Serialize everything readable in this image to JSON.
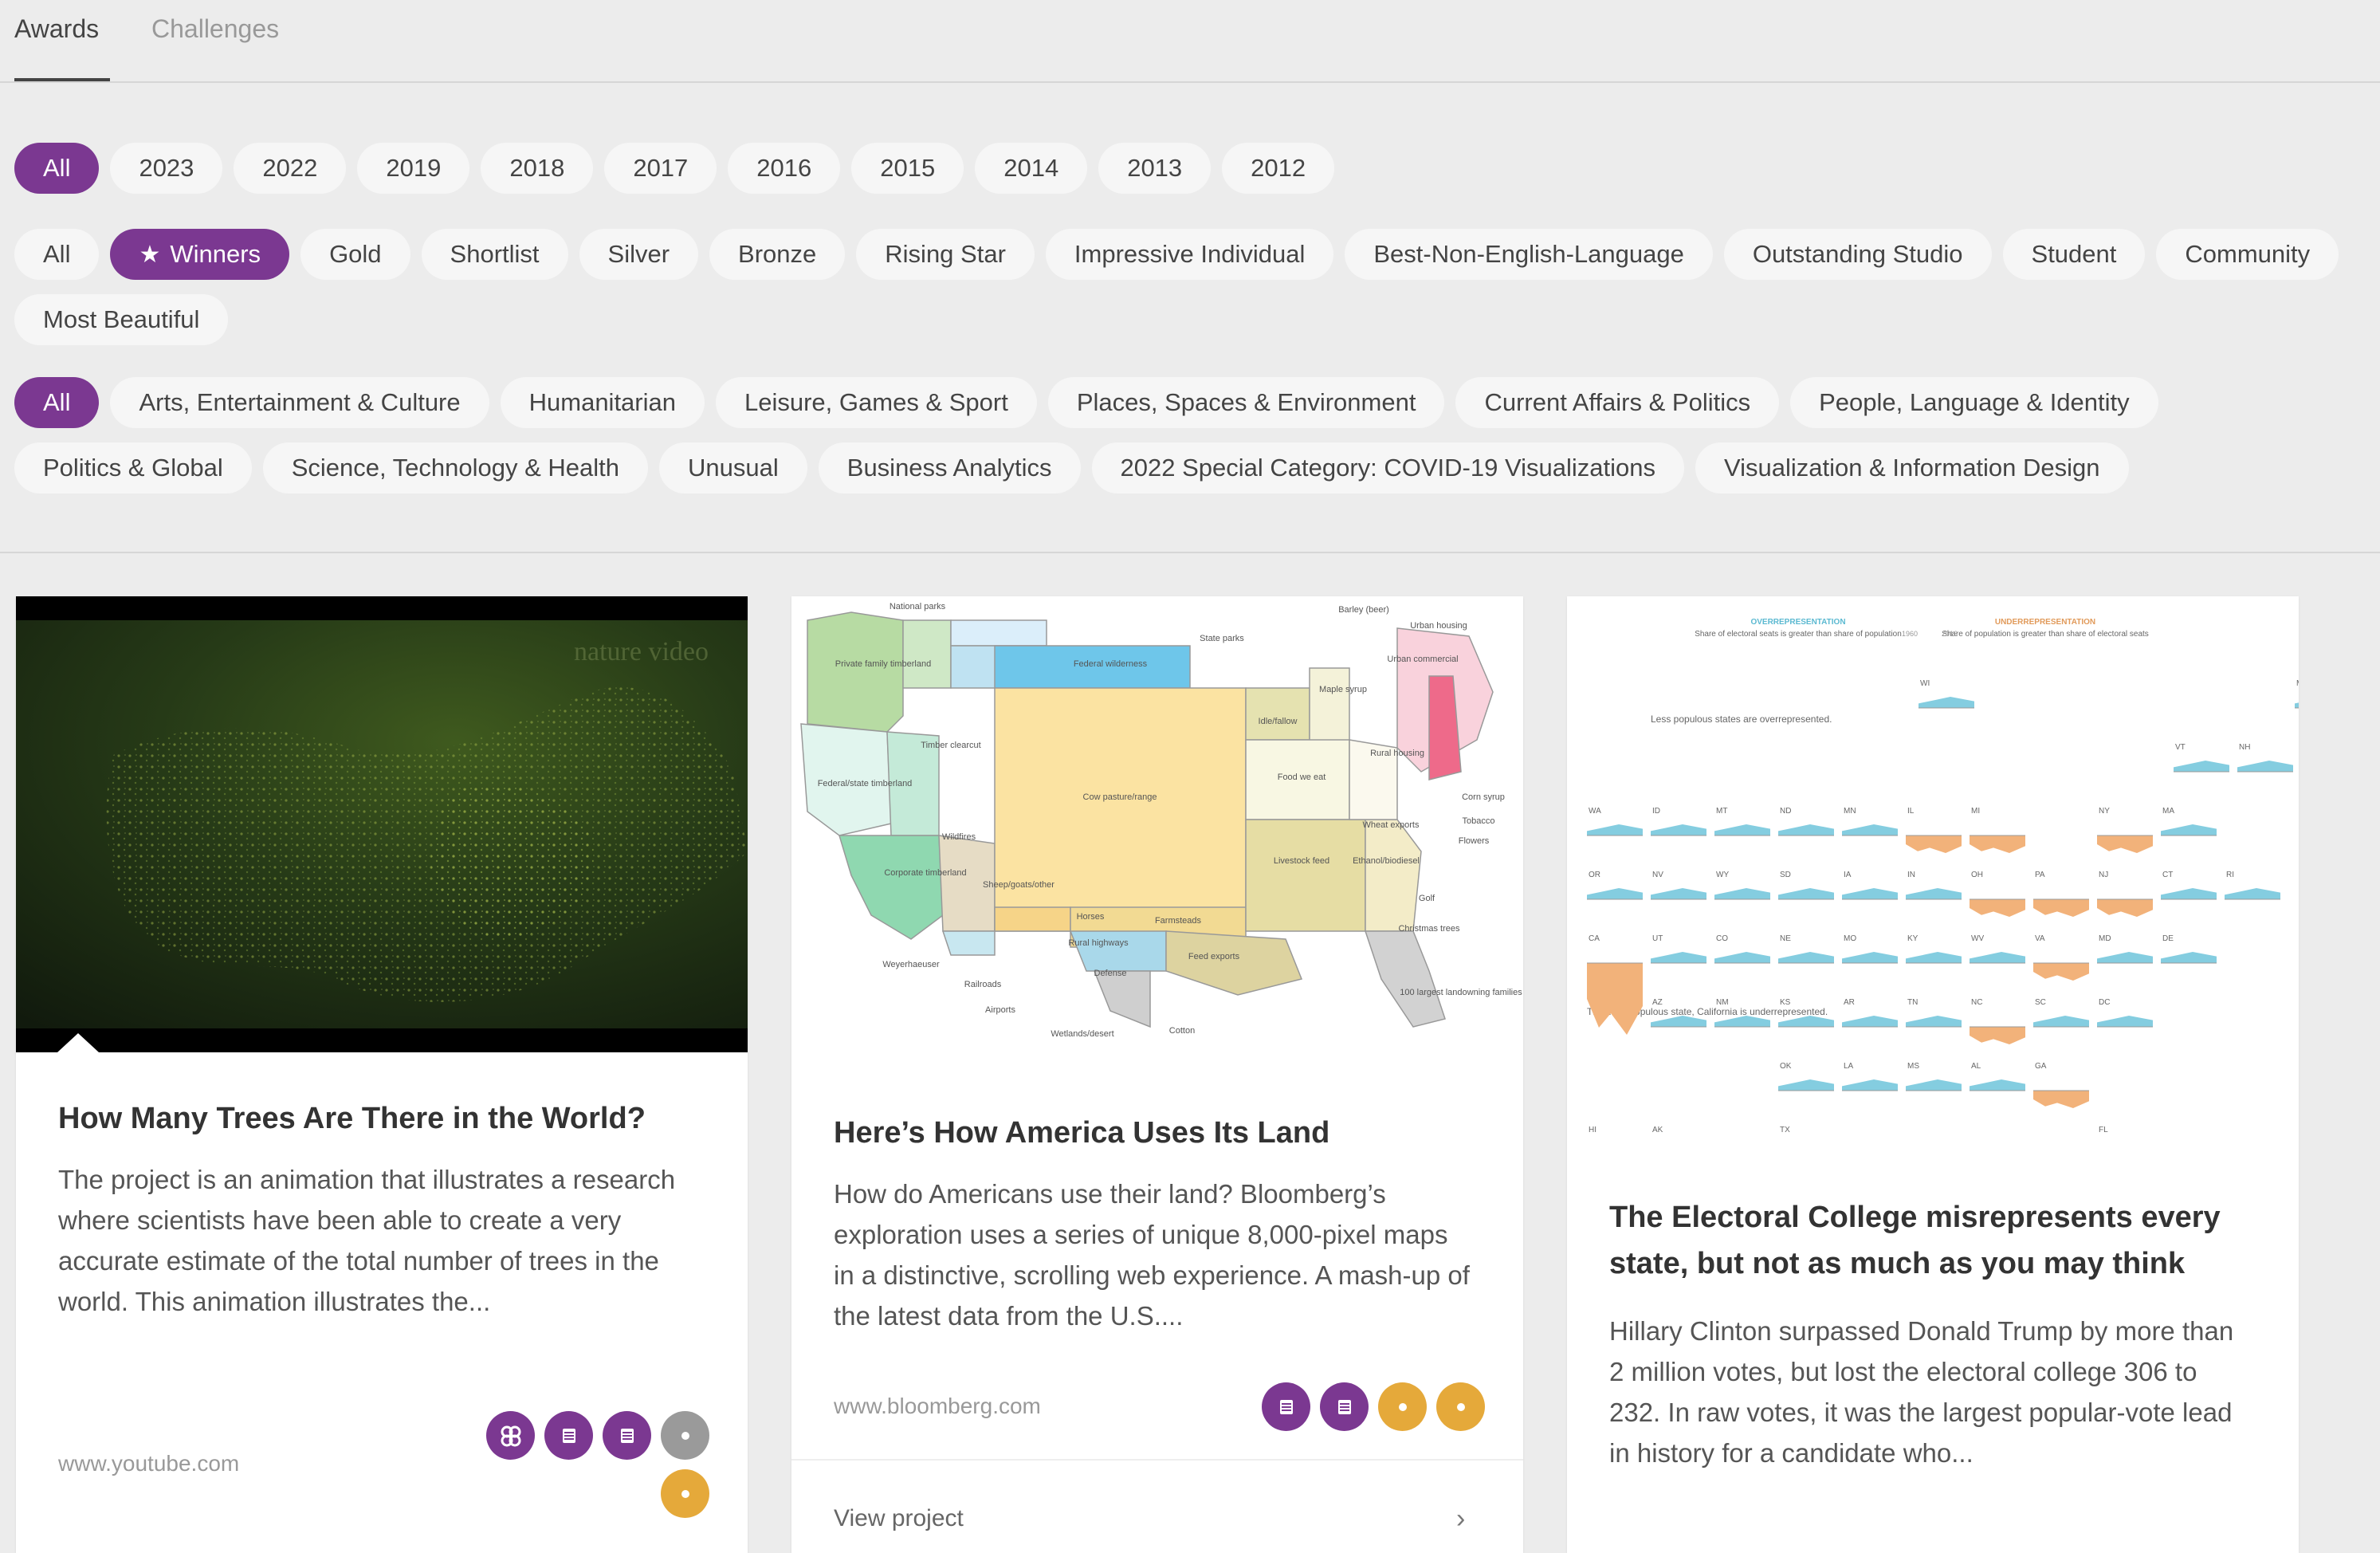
{
  "tabs": [
    {
      "label": "Awards",
      "active": true
    },
    {
      "label": "Challenges",
      "active": false
    }
  ],
  "years": {
    "selected": "All",
    "items": [
      "All",
      "2023",
      "2022",
      "2019",
      "2018",
      "2017",
      "2016",
      "2015",
      "2014",
      "2013",
      "2012"
    ]
  },
  "awards": {
    "selected": "Winners",
    "selected_icon": "star-icon",
    "items": [
      "All",
      "Winners",
      "Gold",
      "Shortlist",
      "Silver",
      "Bronze",
      "Rising Star",
      "Impressive Individual",
      "Best-Non-English-Language",
      "Outstanding Studio",
      "Student",
      "Community",
      "Most Beautiful"
    ]
  },
  "categories": {
    "selected": "All",
    "items": [
      "All",
      "Arts, Entertainment & Culture",
      "Humanitarian",
      "Leisure, Games & Sport",
      "Places, Spaces & Environment",
      "Current Affairs & Politics",
      "People, Language & Identity",
      "Politics & Global",
      "Science, Technology & Health",
      "Unusual",
      "Business Analytics",
      "2022 Special Category: COVID-19 Visualizations",
      "Visualization & Information Design"
    ]
  },
  "colors": {
    "accent": "#7b3891",
    "badge_gray": "#9a9a9a",
    "badge_gold": "#e5a93a"
  },
  "cards": [
    {
      "title": "How Many Trees Are There in the World?",
      "description": "The project is an animation that illustrates a research where scientists have been able to create a very accurate estimate of the total number of trees in the world. This animation illustrates the...",
      "domain": "www.youtube.com",
      "media_watermark": "nature video",
      "badges": [
        {
          "color": "purple",
          "icon": "people-icon"
        },
        {
          "color": "purple",
          "icon": "list-icon"
        },
        {
          "color": "purple",
          "icon": "list-icon"
        },
        {
          "color": "gray",
          "icon": "dot-icon"
        },
        {
          "color": "gold",
          "icon": "dot-icon"
        }
      ]
    },
    {
      "title": "Here’s How America Uses Its Land",
      "description": "How do Americans use their land? Bloomberg’s exploration uses a series of unique 8,000-pixel maps in a distinctive, scrolling web experience. A mash-up of the latest data from the U.S....",
      "domain": "www.bloomberg.com",
      "view_label": "View project",
      "badges": [
        {
          "color": "purple",
          "icon": "list-icon"
        },
        {
          "color": "purple",
          "icon": "list-icon"
        },
        {
          "color": "gold",
          "icon": "dot-icon"
        },
        {
          "color": "gold",
          "icon": "dot-icon"
        }
      ]
    },
    {
      "title": "The Electoral College misrepresents every state, but not as much as you may think",
      "description": "Hillary Clinton surpassed Donald Trump by more than 2 million votes, but lost the electoral college 306 to 232. In raw votes, it was the largest popular-vote lead in history for a candidate who...",
      "badges": []
    }
  ],
  "land_map": {
    "labels": [
      "National parks",
      "Federal wilderness",
      "State parks",
      "Barley (beer)",
      "Urban housing",
      "Urban commercial",
      "Private family timberland",
      "Timber clearcut",
      "Federal/state timberland",
      "Cow pasture/range",
      "Idle/fallow",
      "Maple syrup",
      "Rural housing",
      "Food we eat",
      "Corn syrup",
      "Tobacco",
      "Flowers",
      "Wheat exports",
      "Ethanol/biodiesel",
      "Wildfires",
      "Corporate timberland",
      "Livestock feed",
      "Golf",
      "Sheep/goats/other",
      "Horses",
      "Farmsteads",
      "Christmas trees",
      "Weyerhaeuser",
      "Rural highways",
      "Feed exports",
      "Railroads",
      "Defense",
      "100 largest landowning families",
      "Airports",
      "Wetlands/desert",
      "Cotton"
    ]
  },
  "electoral_chart": {
    "legend_over": "OVERREPRESENTATION",
    "legend_over_note": "Share of electoral seats is greater than share of population",
    "legend_under": "UNDERREPRESENTATION",
    "legend_under_note": "Share of population is greater than share of electoral seats",
    "legend_years": [
      "1960",
      "2016"
    ],
    "note_small": "Less populous states are overrepresented.",
    "note_ca": "The most populous state, California is underrepresented.",
    "states": [
      "ME",
      "WI",
      "VT",
      "NH",
      "WA",
      "ID",
      "MT",
      "ND",
      "MN",
      "IL",
      "MI",
      "NY",
      "MA",
      "OR",
      "NV",
      "WY",
      "SD",
      "IA",
      "IN",
      "OH",
      "PA",
      "NJ",
      "CT",
      "RI",
      "CA",
      "UT",
      "CO",
      "NE",
      "MO",
      "KY",
      "WV",
      "VA",
      "MD",
      "DE",
      "AZ",
      "NM",
      "KS",
      "AR",
      "TN",
      "NC",
      "SC",
      "DC",
      "OK",
      "LA",
      "MS",
      "AL",
      "GA",
      "HI",
      "AK",
      "TX",
      "FL"
    ]
  }
}
